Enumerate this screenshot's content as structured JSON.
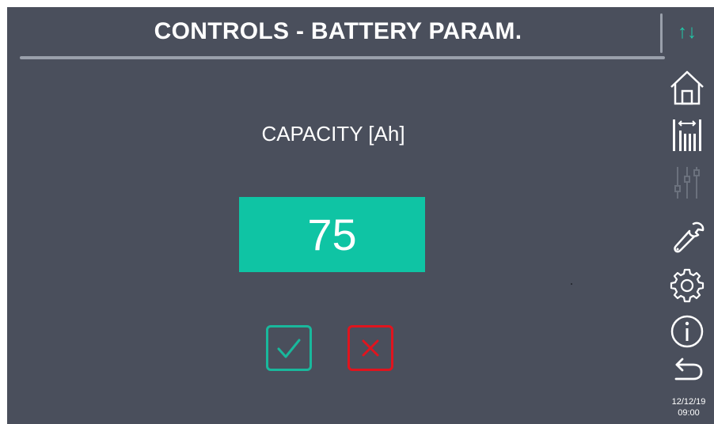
{
  "header": {
    "title": "CONTROLS - BATTERY  PARAM.",
    "updown_glyph": "↑↓"
  },
  "main": {
    "field_label": "CAPACITY [Ah]",
    "value": "75"
  },
  "actions": {
    "confirm_icon": "check-icon",
    "cancel_icon": "x-icon"
  },
  "sidebar": {
    "items": [
      {
        "icon": "home-icon"
      },
      {
        "icon": "battery-bars-icon"
      },
      {
        "icon": "sliders-icon",
        "disabled": true
      },
      {
        "icon": "wrench-icon"
      },
      {
        "icon": "gear-icon"
      },
      {
        "icon": "info-icon"
      },
      {
        "icon": "back-icon"
      }
    ]
  },
  "status": {
    "date": "12/12/19",
    "time": "09:00"
  },
  "colors": {
    "background": "#4a4f5c",
    "accent": "#0fc4a4",
    "confirm": "#19b89c",
    "cancel": "#e0141e",
    "rule": "#9aa0ab",
    "disabled_icon": "#6b717d"
  }
}
